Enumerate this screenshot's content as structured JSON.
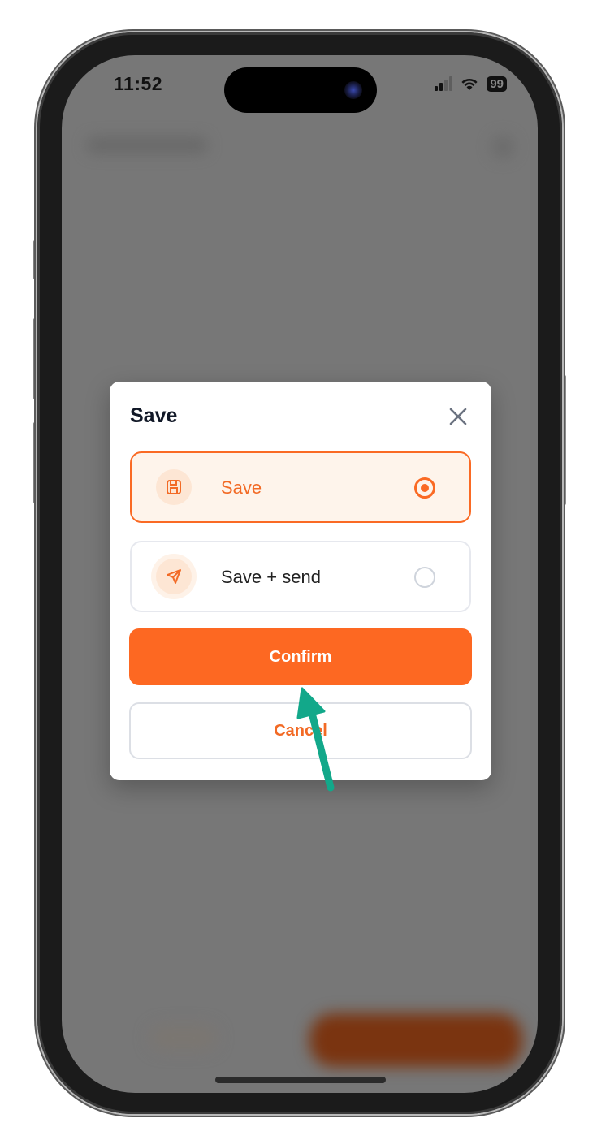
{
  "status_bar": {
    "time": "11:52",
    "battery": "99",
    "icons": [
      "cellular-signal-icon",
      "wifi-icon",
      "battery-icon"
    ]
  },
  "modal": {
    "title": "Save",
    "close_icon": "close-icon",
    "options": [
      {
        "label": "Save",
        "icon": "floppy-disk-icon",
        "selected": true
      },
      {
        "label": "Save + send",
        "icon": "send-icon",
        "selected": false
      }
    ],
    "confirm_label": "Confirm",
    "cancel_label": "Cancel"
  },
  "annotation": {
    "type": "arrow",
    "color": "#12a88a",
    "points_to": "confirm-button"
  },
  "colors": {
    "accent": "#fd6822",
    "selected_bg": "#fef4eb",
    "title": "#111827"
  }
}
